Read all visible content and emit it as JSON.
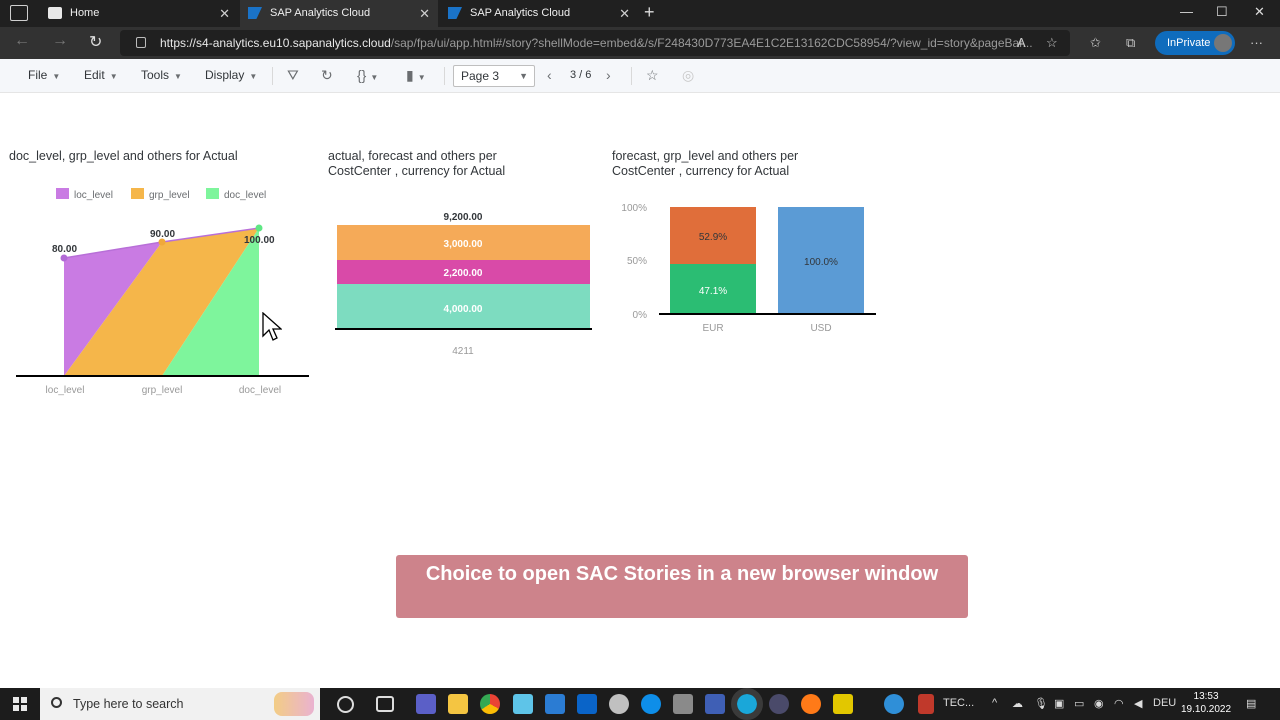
{
  "browser": {
    "tabs": [
      {
        "label": "Home",
        "active": false
      },
      {
        "label": "SAP Analytics Cloud",
        "active": true
      },
      {
        "label": "SAP Analytics Cloud",
        "active": false
      }
    ],
    "url_host": "https://s4-analytics.eu10.sapanalytics.cloud",
    "url_path": "/sap/fpa/ui/app.html#/story?shellMode=embed&/s/F248430D773EA4E1C2E13162CDC58954/?view_id=story&pageBar...",
    "inprivate_label": "InPrivate"
  },
  "toolbar": {
    "menus": [
      "File",
      "Edit",
      "Tools",
      "Display"
    ],
    "page_selector": "Page 3",
    "page_count": "3 / 6"
  },
  "chart1": {
    "title": "doc_level, grp_level and others for Actual",
    "legend": [
      "loc_level",
      "grp_level",
      "doc_level"
    ],
    "labels": [
      "80.00",
      "90.00",
      "100.00"
    ]
  },
  "chart2": {
    "title_line1": "actual, forecast and others per",
    "title_line2": "CostCenter , currency for Actual",
    "total_label": "9,200.00",
    "segment_labels": [
      "3,000.00",
      "2,200.00",
      "4,000.00"
    ],
    "category": "4211"
  },
  "chart3": {
    "title_line1": "forecast, grp_level and others per",
    "title_line2": "CostCenter , currency for Actual",
    "axis_ticks": [
      "100%",
      "50%",
      "0%"
    ],
    "eur_labels": [
      "52.9%",
      "47.1%"
    ],
    "usd_label": "100.0%"
  },
  "chart_data": [
    {
      "type": "area",
      "title": "doc_level, grp_level and others for Actual",
      "categories": [
        "loc_level",
        "grp_level",
        "doc_level"
      ],
      "series": [
        {
          "name": "loc_level",
          "values": [
            80,
            0,
            0
          ],
          "color": "#c97be3"
        },
        {
          "name": "grp_level",
          "values": [
            0,
            90,
            0
          ],
          "color": "#f5b64a"
        },
        {
          "name": "doc_level",
          "values": [
            0,
            0,
            100
          ],
          "color": "#7ef59c"
        }
      ],
      "ylim": [
        0,
        100
      ],
      "legend": "top"
    },
    {
      "type": "bar",
      "title": "actual, forecast and others per CostCenter , currency for Actual",
      "categories": [
        "4211"
      ],
      "stacked": true,
      "series": [
        {
          "values": [
            4000
          ],
          "color": "#7ddcc0"
        },
        {
          "values": [
            2200
          ],
          "color": "#d94aa8"
        },
        {
          "values": [
            3000
          ],
          "color": "#f5aa58"
        }
      ],
      "total": 9200
    },
    {
      "type": "bar",
      "title": "forecast, grp_level and others per CostCenter , currency for Actual",
      "categories": [
        "EUR",
        "USD"
      ],
      "stacked": true,
      "percent": true,
      "series": [
        {
          "values": [
            47.1,
            0
          ],
          "color": "#2bbd73"
        },
        {
          "values": [
            52.9,
            0
          ],
          "color": "#e06e3a"
        },
        {
          "values": [
            0,
            100.0
          ],
          "color": "#5b9bd5"
        }
      ],
      "ylim": [
        0,
        100
      ]
    }
  ],
  "banner": {
    "text": "Choice to open SAC Stories in a new browser window"
  },
  "taskbar": {
    "search_placeholder": "Type here to search",
    "app_label": "TEC...",
    "language": "DEU",
    "time": "13:53",
    "date": "19.10.2022"
  }
}
